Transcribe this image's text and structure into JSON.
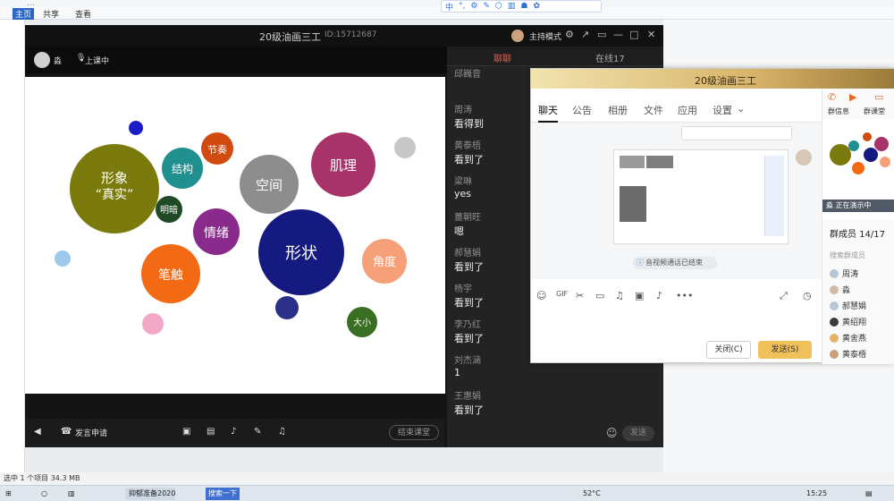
{
  "background": {
    "title": "...",
    "ribbon_tabs": [
      "主页",
      "共享",
      "查看"
    ],
    "status_text": "选中 1 个项目 34.3 MB"
  },
  "toolbar_icons": [
    "中",
    "°,",
    "⚙",
    "✎",
    "⬡",
    "▥",
    "☗",
    "✿"
  ],
  "meeting": {
    "title": "20级油画三工",
    "room_id": "ID:15712687",
    "host_mode": "主持模式",
    "presenter_name": "淼",
    "presenter_status": "上课中",
    "slide_bubbles": [
      {
        "label": "形象\n“真实”",
        "color": "#7b7b0d"
      },
      {
        "label": "结构",
        "color": "#1f8f8f"
      },
      {
        "label": "节奏",
        "color": "#d14a10"
      },
      {
        "label": "明暗",
        "color": "#1f4a25"
      },
      {
        "label": "空间",
        "color": "#8d8d8d"
      },
      {
        "label": "肌理",
        "color": "#a8336a"
      },
      {
        "label": "情绪",
        "color": "#8a2a8c"
      },
      {
        "label": "形状",
        "color": "#151a80"
      },
      {
        "label": "笔触",
        "color": "#f26a13"
      },
      {
        "label": "角度",
        "color": "#f6a079"
      },
      {
        "label": "大小",
        "color": "#3a6e23"
      }
    ],
    "bottom": {
      "apply_label": "发言申请",
      "end_button": "结束课堂"
    },
    "chat_tabs": {
      "chat": "聊聊",
      "online": "在线17"
    },
    "messages": [
      {
        "name": "邱巍音",
        "text": ""
      },
      {
        "name": "周涛",
        "text": "看得到"
      },
      {
        "name": "黄泰梧",
        "text": "看到了"
      },
      {
        "name": "梁琳",
        "text": "yes"
      },
      {
        "name": "薑朝旺",
        "text": "嗯"
      },
      {
        "name": "郝慧娟",
        "text": "看到了"
      },
      {
        "name": "杨宇",
        "text": "看到了"
      },
      {
        "name": "李乃红",
        "text": "看到了"
      },
      {
        "name": "刘杰涵",
        "text": "1"
      },
      {
        "name": "王惠娟",
        "text": "看到了"
      }
    ],
    "send_label": "发送"
  },
  "qq": {
    "title": "20级油画三工",
    "tabs": [
      "聊天",
      "公告",
      "相册",
      "文件",
      "应用",
      "设置"
    ],
    "system_note": "音视频通话已结束",
    "close_label": "关闭(C)",
    "send_label": "发送(S)",
    "side_links": [
      "群信息",
      "群课堂"
    ],
    "live_note": "淼 正在演示中",
    "member_count": "群成员 14/17",
    "member_search": "搜索群成员",
    "members": [
      "周涛",
      "淼",
      "郝慧娟",
      "黄绍翔",
      "黄舍燕",
      "黄泰梧"
    ]
  },
  "taskbar": {
    "task1": "抑郁准备2020",
    "task2": "搜索一下",
    "temp": "52°C",
    "time": "15:25"
  }
}
